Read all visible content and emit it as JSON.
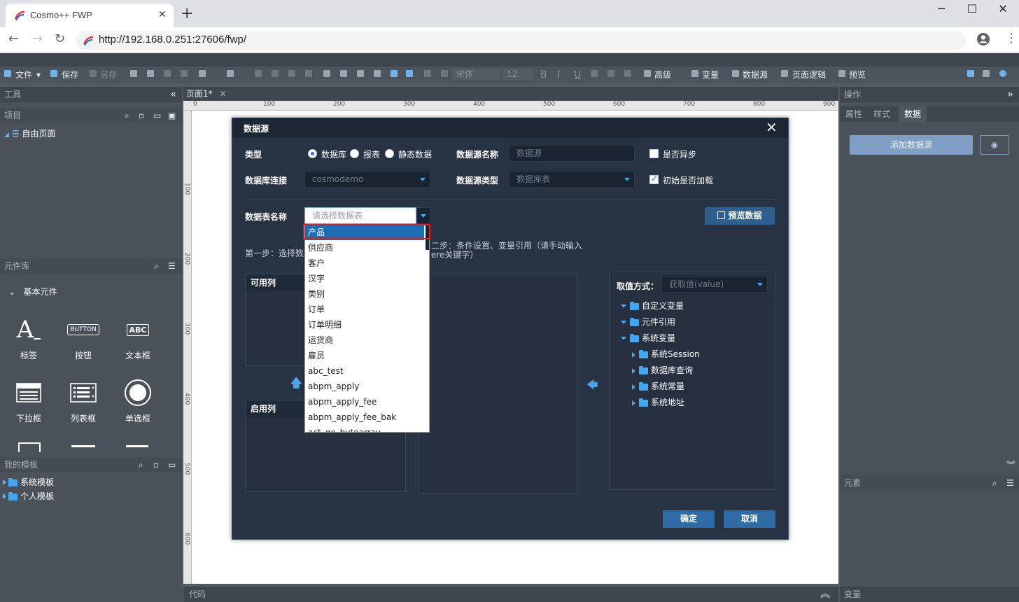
{
  "browser": {
    "tab_title": "Cosmo++ FWP",
    "url": "http://192.168.0.251:27606/fwp/",
    "min": "─",
    "max": "☐",
    "close": "✕"
  },
  "toolbar": {
    "file": "文件",
    "save": "保存",
    "save_as": "另存",
    "font": "宋体",
    "font_size": "12",
    "bold": "B",
    "italic": "I",
    "underline": "U",
    "advanced": "高级",
    "variable": "变量",
    "datasource": "数据源",
    "page_logic": "页面逻辑",
    "preview": "预览"
  },
  "left": {
    "tools_title": "工具",
    "project_title": "项目",
    "free_page": "自由页面",
    "lib_title": "元件库",
    "basic_components": "基本元件",
    "components": [
      "标签",
      "按钮",
      "文本框",
      "下拉框",
      "列表框",
      "单选框"
    ],
    "button_icon_text": "BUTTON",
    "textbox_icon_text": "ABC",
    "my_templates_title": "我的模板",
    "system_templates": "系统模板",
    "personal_templates": "个人模板"
  },
  "canvas": {
    "page_tab": "页面1*",
    "ruler_h": [
      "0",
      "100",
      "200",
      "300",
      "400",
      "500",
      "600",
      "700",
      "800",
      "900"
    ],
    "ruler_v": [
      "100",
      "200",
      "300",
      "400",
      "500",
      "600"
    ],
    "code_label": "代码"
  },
  "right": {
    "ops_title": "操作",
    "tabs": [
      "属性",
      "样式",
      "数据"
    ],
    "add_datasource": "添加数据源",
    "elements_title": "元素",
    "variables_title": "变量"
  },
  "modal": {
    "title": "数据源",
    "type_label": "类型",
    "type_options": [
      "数据库",
      "报表",
      "静态数据"
    ],
    "ds_name_label": "数据源名称",
    "ds_name_placeholder": "数据源",
    "async_label": "是否异步",
    "db_conn_label": "数据库连接",
    "db_conn_value": "cosmodemo",
    "ds_type_label": "数据源类型",
    "ds_type_value": "数据库表",
    "init_load_label": "初始是否加载",
    "table_name_label": "数据表名称",
    "table_name_placeholder": "请选择数据表",
    "preview_data": "预览数据",
    "step1": "第一步：选择数",
    "step2_a": "二步：条件设置、变量引用（请手动输入",
    "step2_b": "ere关键字）",
    "available_cols": "可用列",
    "enabled_cols": "启用列",
    "value_mode_label": "取值方式：",
    "value_mode_value": "获取值(value)",
    "var_tree": [
      "自定义变量",
      "元件引用",
      "系统变量",
      "系统Session",
      "数据库查询",
      "系统常量",
      "系统地址"
    ],
    "ok": "确定",
    "cancel": "取消"
  },
  "dropdown": {
    "items": [
      "产品",
      "供应商",
      "客户",
      "汉字",
      "类别",
      "订单",
      "订单明细",
      "运货商",
      "雇员",
      "abc_test",
      "abpm_apply",
      "abpm_apply_fee",
      "abpm_apply_fee_bak",
      "act_ge_bytearray"
    ]
  },
  "colors": {
    "modal_bg": "#273243",
    "accent": "#2f6ca6",
    "selected": "#1c6db4",
    "highlight_border": "#e02020"
  }
}
